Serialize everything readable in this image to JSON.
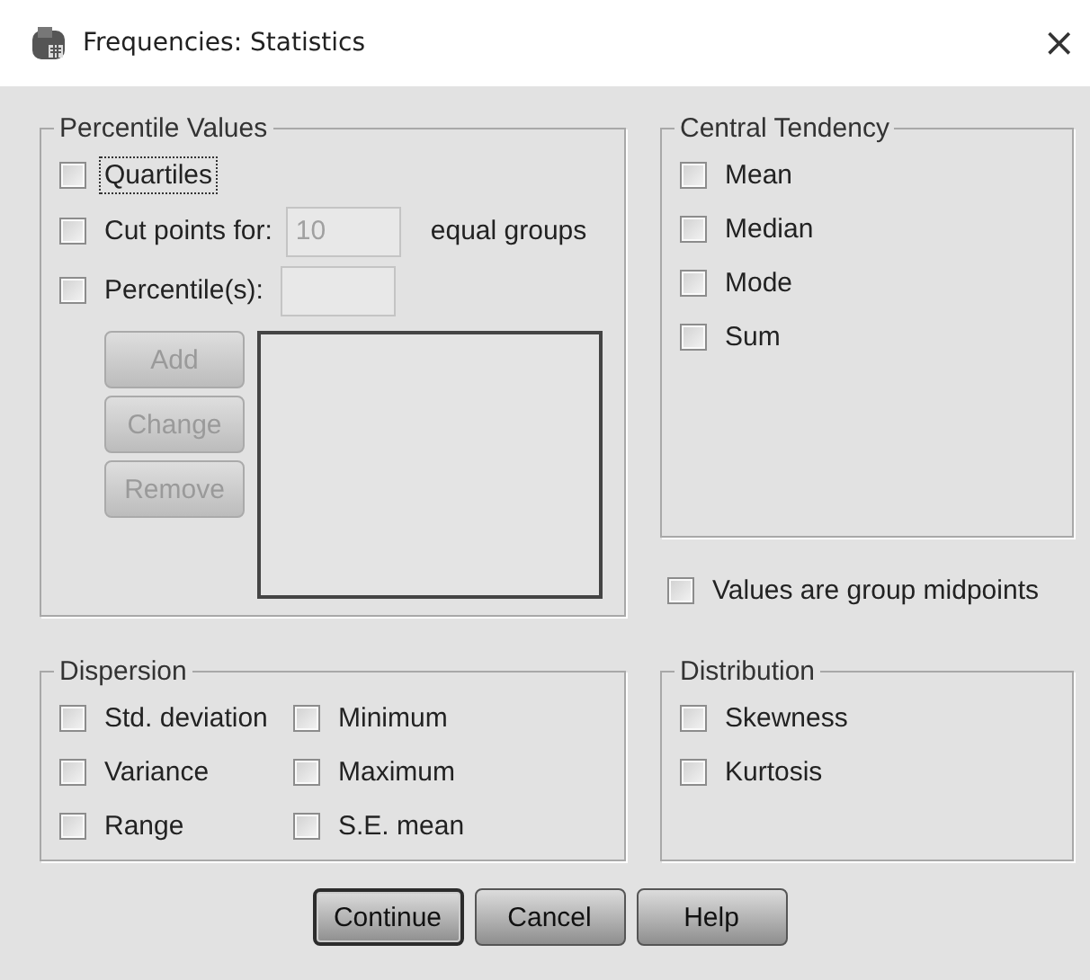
{
  "window": {
    "title": "Frequencies: Statistics",
    "close": "×"
  },
  "percentile_values": {
    "title": "Percentile Values",
    "quartiles": {
      "label": "Quartiles",
      "checked": false,
      "focused": true
    },
    "cut_points": {
      "label": "Cut points for:",
      "checked": false,
      "value": "10",
      "disabled": true,
      "suffix": "equal groups"
    },
    "percentiles": {
      "label": "Percentile(s):",
      "checked": false
    },
    "buttons": [
      {
        "label": "Add",
        "disabled": true
      },
      {
        "label": "Change",
        "disabled": true
      },
      {
        "label": "Remove",
        "disabled": true
      }
    ]
  },
  "central_tendency": {
    "title": "Central Tendency",
    "items": [
      {
        "label": "Mean",
        "checked": false
      },
      {
        "label": "Median",
        "checked": false
      },
      {
        "label": "Mode",
        "checked": false
      },
      {
        "label": "Sum",
        "checked": false
      }
    ]
  },
  "group_midpoints": {
    "label": "Values are group midpoints",
    "checked": false
  },
  "dispersion": {
    "title": "Dispersion",
    "items": [
      {
        "label": "Std. deviation",
        "checked": false
      },
      {
        "label": "Minimum",
        "checked": false
      },
      {
        "label": "Variance",
        "checked": false
      },
      {
        "label": "Maximum",
        "checked": false
      },
      {
        "label": "Range",
        "checked": false
      },
      {
        "label": "S.E. mean",
        "checked": false
      }
    ]
  },
  "distribution": {
    "title": "Distribution",
    "items": [
      {
        "label": "Skewness",
        "checked": false
      },
      {
        "label": "Kurtosis",
        "checked": false
      }
    ]
  },
  "buttons": [
    {
      "label": "Continue",
      "default": true
    },
    {
      "label": "Cancel",
      "default": false
    },
    {
      "label": "Help",
      "default": false
    }
  ]
}
